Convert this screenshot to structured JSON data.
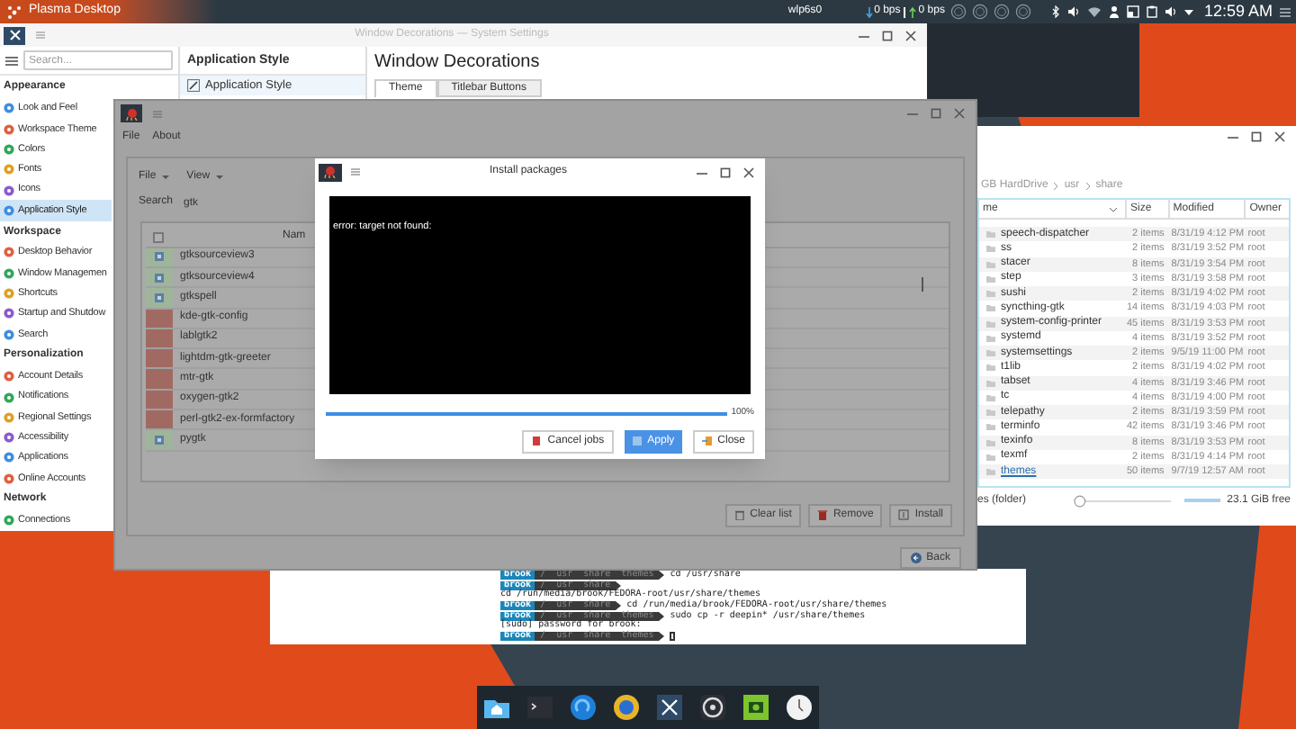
{
  "top_panel": {
    "title": "Plasma Desktop",
    "network_interface": "wlp6s0",
    "download_rate": "0 bps",
    "upload_rate": "0 bps",
    "clock": "12:59 AM"
  },
  "system_settings": {
    "title": "Window Decorations — System Settings",
    "search": {
      "placeholder": "Search..."
    },
    "categories": [
      {
        "title": "Appearance",
        "items": [
          {
            "label": "Look and Feel",
            "selected": false
          },
          {
            "label": "Workspace Theme",
            "selected": false
          },
          {
            "label": "Colors",
            "selected": false
          },
          {
            "label": "Fonts",
            "selected": false
          },
          {
            "label": "Icons",
            "selected": false
          },
          {
            "label": "Application Style",
            "selected": true
          }
        ]
      },
      {
        "title": "Workspace",
        "items": [
          {
            "label": "Desktop Behavior",
            "selected": false
          },
          {
            "label": "Window Managemen",
            "selected": false
          },
          {
            "label": "Shortcuts",
            "selected": false
          },
          {
            "label": "Startup and Shutdow",
            "selected": false
          },
          {
            "label": "Search",
            "selected": false
          }
        ]
      },
      {
        "title": "Personalization",
        "items": [
          {
            "label": "Account Details",
            "selected": false
          },
          {
            "label": "Notifications",
            "selected": false
          },
          {
            "label": "Regional Settings",
            "selected": false
          },
          {
            "label": "Accessibility",
            "selected": false
          },
          {
            "label": "Applications",
            "selected": false
          },
          {
            "label": "Online Accounts",
            "selected": false
          }
        ]
      },
      {
        "title": "Network",
        "items": [
          {
            "label": "Connections",
            "selected": false
          }
        ]
      }
    ],
    "subpanel": {
      "heading": "Application Style",
      "items": [
        {
          "label": "Application Style",
          "selected": true
        }
      ]
    },
    "page": {
      "heading": "Window Decorations",
      "tabs": [
        {
          "label": "Theme",
          "selected": true
        },
        {
          "label": "Titlebar Buttons",
          "selected": false
        }
      ]
    }
  },
  "package_manager": {
    "menu": [
      "File",
      "About"
    ],
    "toolbar": [
      "File",
      "View"
    ],
    "search": {
      "label": "Search",
      "value": "gtk"
    },
    "select_all": {
      "checked": false
    },
    "name_column": "Nam",
    "packages": [
      {
        "name": "gtksourceview3",
        "installed": true
      },
      {
        "name": "gtksourceview4",
        "installed": true
      },
      {
        "name": "gtkspell",
        "installed": true
      },
      {
        "name": "kde-gtk-config",
        "installed": false
      },
      {
        "name": "lablgtk2",
        "installed": false
      },
      {
        "name": "lightdm-gtk-greeter",
        "installed": false
      },
      {
        "name": "mtr-gtk",
        "installed": false
      },
      {
        "name": "oxygen-gtk2",
        "installed": false
      },
      {
        "name": "perl-gtk2-ex-formfactory",
        "installed": false
      },
      {
        "name": "pygtk",
        "installed": true
      }
    ],
    "buttons": [
      "Clear list",
      "Remove",
      "Install"
    ],
    "back_button": "Back"
  },
  "install_dialog": {
    "title": "Install packages",
    "output": "error: target not found:",
    "progress": {
      "level": 1,
      "reading": "100%"
    },
    "buttons": [
      {
        "label": "Cancel jobs",
        "primary": false
      },
      {
        "label": "Apply",
        "primary": true
      },
      {
        "label": "Close",
        "primary": false
      }
    ]
  },
  "file_manager": {
    "breadcrumb": [
      "GB HardDrive",
      "usr",
      "share"
    ],
    "columns": [
      "me",
      "Size",
      "Modified",
      "Owner"
    ],
    "rows": [
      {
        "name": "speech-dispatcher",
        "size": "2 items",
        "modified": "8/31/19 4:12 PM",
        "owner": "root",
        "selected": false
      },
      {
        "name": "ss",
        "size": "2 items",
        "modified": "8/31/19 3:52 PM",
        "owner": "root",
        "selected": false
      },
      {
        "name": "stacer",
        "size": "8 items",
        "modified": "8/31/19 3:54 PM",
        "owner": "root",
        "selected": false
      },
      {
        "name": "step",
        "size": "3 items",
        "modified": "8/31/19 3:58 PM",
        "owner": "root",
        "selected": false
      },
      {
        "name": "sushi",
        "size": "2 items",
        "modified": "8/31/19 4:02 PM",
        "owner": "root",
        "selected": false
      },
      {
        "name": "syncthing-gtk",
        "size": "14 items",
        "modified": "8/31/19 4:03 PM",
        "owner": "root",
        "selected": false
      },
      {
        "name": "system-config-printer",
        "size": "45 items",
        "modified": "8/31/19 3:53 PM",
        "owner": "root",
        "selected": false
      },
      {
        "name": "systemd",
        "size": "4 items",
        "modified": "8/31/19 3:52 PM",
        "owner": "root",
        "selected": false
      },
      {
        "name": "systemsettings",
        "size": "2 items",
        "modified": "9/5/19 11:00 PM",
        "owner": "root",
        "selected": false
      },
      {
        "name": "t1lib",
        "size": "2 items",
        "modified": "8/31/19 4:02 PM",
        "owner": "root",
        "selected": false
      },
      {
        "name": "tabset",
        "size": "4 items",
        "modified": "8/31/19 3:46 PM",
        "owner": "root",
        "selected": false
      },
      {
        "name": "tc",
        "size": "4 items",
        "modified": "8/31/19 4:00 PM",
        "owner": "root",
        "selected": false
      },
      {
        "name": "telepathy",
        "size": "2 items",
        "modified": "8/31/19 3:59 PM",
        "owner": "root",
        "selected": false
      },
      {
        "name": "terminfo",
        "size": "42 items",
        "modified": "8/31/19 3:46 PM",
        "owner": "root",
        "selected": false
      },
      {
        "name": "texinfo",
        "size": "8 items",
        "modified": "8/31/19 3:53 PM",
        "owner": "root",
        "selected": false
      },
      {
        "name": "texmf",
        "size": "2 items",
        "modified": "8/31/19 4:14 PM",
        "owner": "root",
        "selected": false
      },
      {
        "name": "themes",
        "size": "50 items",
        "modified": "9/7/19 12:57 AM",
        "owner": "root",
        "selected": true
      }
    ],
    "status": "es (folder)",
    "zoom": {
      "level": 0
    },
    "free_space": "23.1 GiB free"
  },
  "terminal": {
    "lines": [
      {
        "kind": "prompt",
        "segments": [
          "brook",
          "/",
          "usr",
          "share",
          "themes"
        ],
        "command": "cd /usr/share"
      },
      {
        "kind": "prompt",
        "segments": [
          "brook",
          "/",
          "usr",
          "share"
        ]
      },
      {
        "kind": "output",
        "text": "cd /run/media/brook/FEDORA-root/usr/share/themes"
      },
      {
        "kind": "prompt",
        "segments": [
          "brook",
          "/",
          "usr",
          "share"
        ],
        "command": "cd /run/media/brook/FEDORA-root/usr/share/themes"
      },
      {
        "kind": "prompt",
        "segments": [
          "brook",
          "/",
          "usr",
          "share",
          "themes"
        ],
        "command": "sudo cp -r deepin* /usr/share/themes"
      },
      {
        "kind": "output",
        "text": "[sudo] password for brook:"
      },
      {
        "kind": "prompt",
        "segments": [
          "brook",
          "/",
          "usr",
          "share",
          "themes"
        ],
        "cursor": true
      }
    ]
  }
}
